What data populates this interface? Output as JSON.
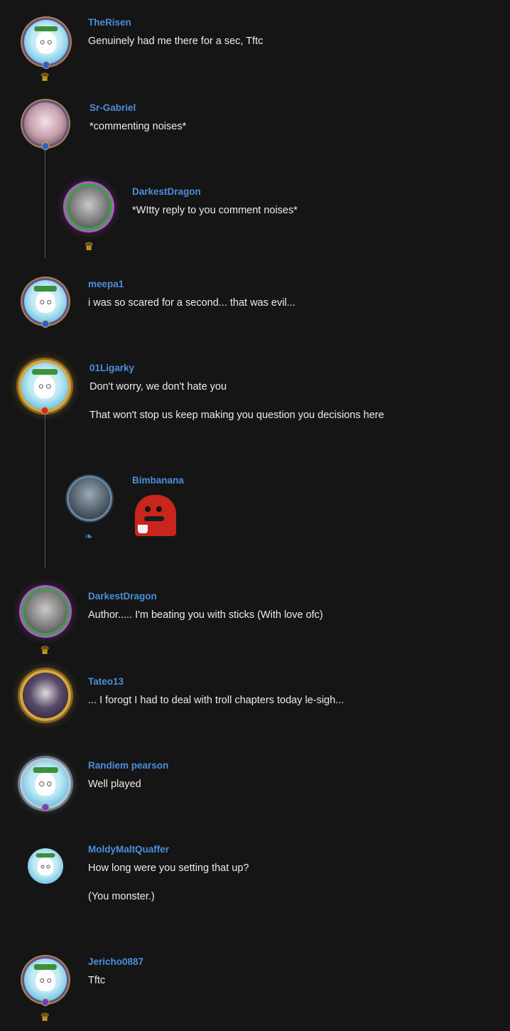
{
  "comments": [
    {
      "username": "TheRisen",
      "lines": [
        "Genuinely had me there for a sec, Tftc"
      ],
      "badge": "crown-icon"
    },
    {
      "username": "Sr-Gabriel",
      "lines": [
        "*commenting noises*"
      ]
    },
    {
      "username": "DarkestDragon",
      "lines": [
        "*WItty reply to you comment noises*"
      ],
      "badge": "crown-icon",
      "reply": true
    },
    {
      "username": "meepa1",
      "lines": [
        "i was so scared for a second... that was evil..."
      ]
    },
    {
      "username": "01Ligarky",
      "lines": [
        "Don't worry, we don't hate you",
        "That won't stop us keep making you question you decisions here"
      ]
    },
    {
      "username": "Bimbanana",
      "lines": [],
      "badge": "feather-icon",
      "reply": true,
      "sticker": "red-dinosaur-sticker"
    },
    {
      "username": "DarkestDragon",
      "lines": [
        "Author..... I'm beating you with sticks (With love ofc)"
      ],
      "badge": "crown-icon"
    },
    {
      "username": "Tateo13",
      "lines": [
        "... I forogt I had to deal with troll chapters today le-sigh..."
      ]
    },
    {
      "username": "Randiem pearson",
      "lines": [
        "Well played"
      ]
    },
    {
      "username": "MoldyMaltQuaffer",
      "lines": [
        "How long were you setting that up?",
        "(You monster.)"
      ]
    },
    {
      "username": "Jericho0887",
      "lines": [
        "Tftc"
      ],
      "badge": "crown-icon"
    }
  ],
  "icons": {
    "crown": "♛",
    "feather": "❧"
  },
  "colors": {
    "background": "#151515",
    "username": "#4a8fdb",
    "text": "#ececec",
    "crown": "#f1b51f"
  }
}
